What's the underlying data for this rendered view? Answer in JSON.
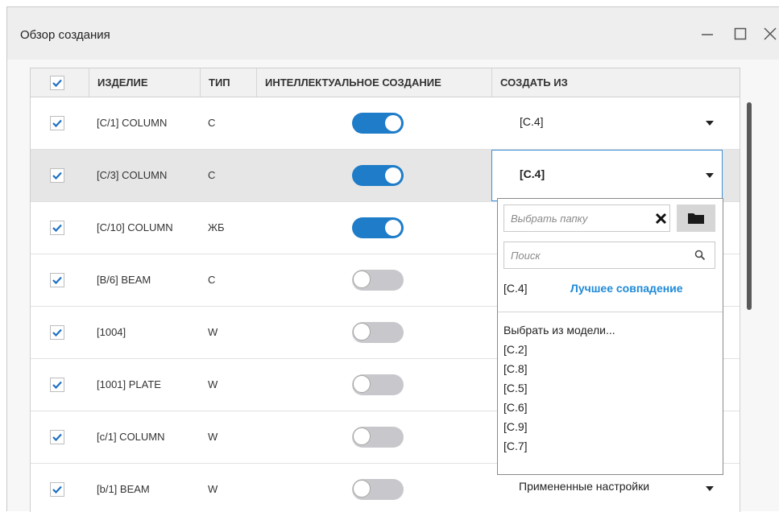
{
  "window": {
    "title": "Обзор создания",
    "minimize_icon": "minimize-icon",
    "maximize_icon": "maximize-icon",
    "close_icon": "close-icon"
  },
  "colors": {
    "accent": "#1e7cc8",
    "link": "#1f8ad8",
    "toggle_off": "#c8c8cc",
    "focus_border": "#3c8fd6"
  },
  "table": {
    "headers": {
      "select_all_checked": true,
      "item": "ИЗДЕЛИЕ",
      "type": "ТИП",
      "smart": "ИНТЕЛЛЕКТУАЛЬНОЕ СОЗДАНИЕ",
      "create_from": "СОЗДАТЬ ИЗ"
    },
    "rows": [
      {
        "checked": true,
        "item": "[C/1] COLUMN",
        "type": "C",
        "smart": true,
        "create_from": "[C.4]"
      },
      {
        "checked": true,
        "item": "[C/3] COLUMN",
        "type": "C",
        "smart": true,
        "create_from": "[C.4]",
        "selected": true
      },
      {
        "checked": true,
        "item": "[C/10] COLUMN",
        "type": "ЖБ",
        "smart": true,
        "create_from": ""
      },
      {
        "checked": true,
        "item": "[B/6] BEAM",
        "type": "C",
        "smart": false,
        "create_from": ""
      },
      {
        "checked": true,
        "item": "[1004]",
        "type": "W",
        "smart": false,
        "create_from": ""
      },
      {
        "checked": true,
        "item": "[1001] PLATE",
        "type": "W",
        "smart": false,
        "create_from": ""
      },
      {
        "checked": true,
        "item": "[c/1] COLUMN",
        "type": "W",
        "smart": false,
        "create_from": ""
      },
      {
        "checked": true,
        "item": "[b/1] BEAM",
        "type": "W",
        "smart": false,
        "create_from": "Примененные настройки"
      }
    ]
  },
  "dropdown": {
    "folder_placeholder": "Выбрать папку",
    "clear_icon": "close-x-icon",
    "folder_icon": "folder-icon",
    "search_placeholder": "Поиск",
    "search_icon": "search-icon",
    "best_match_value": "[C.4]",
    "best_match_label": "Лучшее совпадение",
    "items": [
      "Выбрать из модели...",
      "[C.2]",
      "[C.8]",
      "[C.5]",
      "[C.6]",
      "[C.9]",
      "[C.7]"
    ]
  }
}
